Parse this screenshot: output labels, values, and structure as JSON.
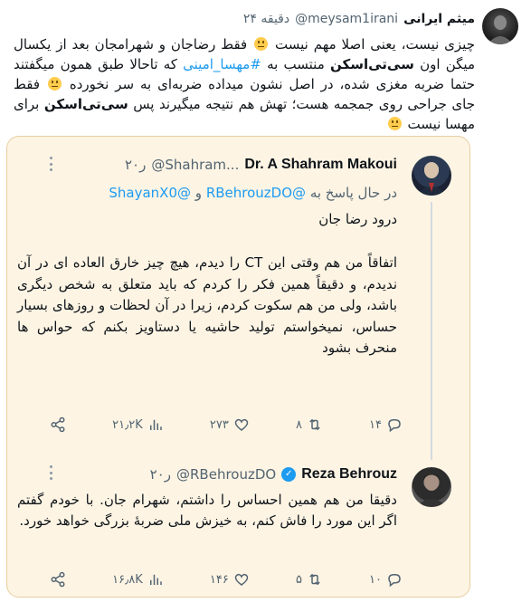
{
  "main_tweet": {
    "name": "میثم ایرانی",
    "handle": "@meysam1irani",
    "time": "۲۴ دقیقه",
    "text_segments": {
      "s1": "چیزی نیست، یعنی اصلا مهم نیست",
      "s2": "فقط رضاجان و شهرامجان بعد از یکسال میگن اون",
      "s3": "سی‌تی‌اسکن",
      "s4": "منتسب به",
      "s5": "#مهسا_امینی",
      "s6": "که تاحالا طبق همون میگفتند حتما ضربه مغزی شده، در اصل نشون میداده ضربه‌ای به سر نخورده",
      "s7": "فقط جای جراحی روی جمجمه هست؛ تهش هم نتیجه میگیرند پس",
      "s8": "سی‌تی‌اسکن",
      "s9": "برای مهسا نیست"
    }
  },
  "quote1": {
    "name": "Dr. A Shahram Makoui",
    "handle": "@Shahram...",
    "time": "۲۰ر",
    "replying_prefix": "در حال پاسخ به",
    "replying_user1": "@RBehrouzDO",
    "replying_and": "و",
    "replying_user2": "@ShayanX0",
    "greeting": "درود رضا جان",
    "body": "اتفاقاً من هم وقتی این CT را دیدم، هیچ چیز خارق العاده ای در آن ندیدم، و دقیقاً همین فکر را کردم که باید متعلق به شخص دیگری باشد، ولی من هم سکوت کردم، زیرا در آن لحظات و روزهای بسیار حساس، نمیخواستم تولید حاشیه یا دستاویز بکنم که حواس ها منحرف بشود",
    "stats": {
      "replies": "۱۴",
      "retweets": "۸",
      "likes": "۲۷۳",
      "views": "۲۱٫۲K"
    }
  },
  "quote2": {
    "name": "Reza Behrouz",
    "verified_mark": "✓",
    "handle": "@RBehrouzDO",
    "time": "۲۰ر",
    "body": "دقیقا من هم همین احساس را داشتم، شهرام جان. با خودم گفتم اگر این مورد را فاش کنم، به خیزش ملی ضربهٔ بزرگی خواهد خورد.",
    "stats": {
      "replies": "۱۰",
      "retweets": "۵",
      "likes": "۱۴۶",
      "views": "۱۶٫۸K"
    }
  },
  "colors": {
    "link": "#1d9bf0",
    "card_bg": "#fdf4e4",
    "card_border": "#e8cfa0",
    "muted": "#536471"
  },
  "icons": [
    "reply-icon",
    "retweet-icon",
    "like-icon",
    "views-icon",
    "share-icon",
    "more-icon",
    "verified-icon",
    "smile-emoji"
  ]
}
